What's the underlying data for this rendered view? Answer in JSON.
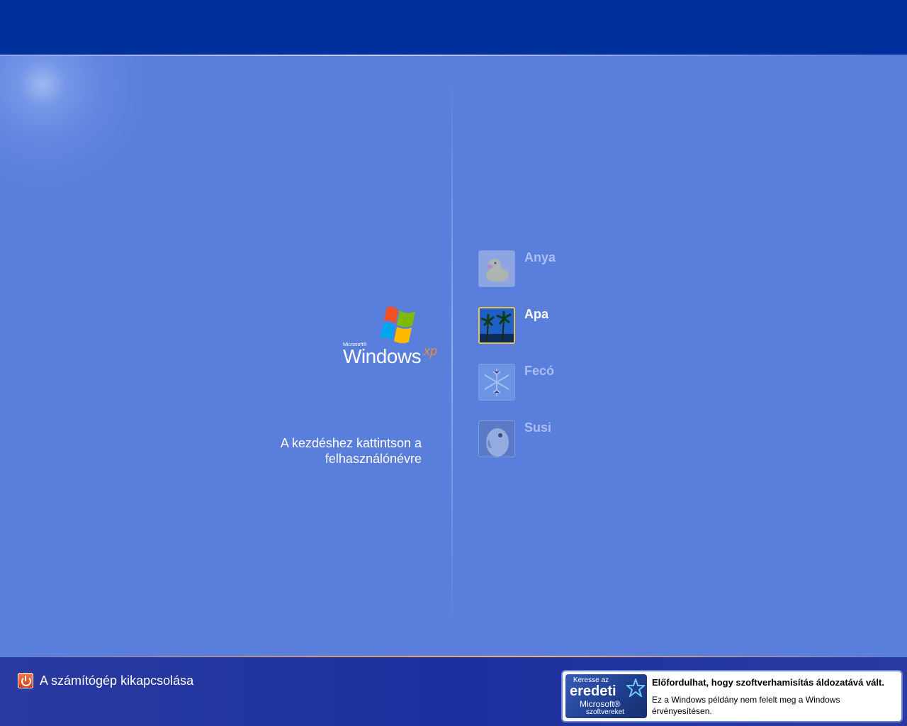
{
  "logo": {
    "microsoft": "Microsoft®",
    "windows": "Windows",
    "xp": "xp"
  },
  "instruction": {
    "line1": "A kezdéshez kattintson a",
    "line2": "felhasználónévre"
  },
  "users": [
    {
      "name": "Anya",
      "picture": "duck-icon",
      "selected": false
    },
    {
      "name": "Apa",
      "picture": "palm-trees-icon",
      "selected": true
    },
    {
      "name": "Fecó",
      "picture": "snowflake-icon",
      "selected": false
    },
    {
      "name": "Susi",
      "picture": "parrot-icon",
      "selected": false
    }
  ],
  "shutdown": {
    "label": "A számítógép kikapcsolása",
    "icon": "power-icon"
  },
  "notice": {
    "badge_line1": "Keresse az",
    "badge_line2": "eredeti",
    "badge_line3": "Microsoft®",
    "badge_line4": "szoftvereket",
    "title": "Előfordulhat, hogy szoftverhamisítás áldozatává vált.",
    "body": "Ez a Windows példány nem felelt meg a Windows érvényesítésen."
  },
  "colors": {
    "top_bar": "#00309c",
    "background": "#5a7edc",
    "bottom_bar": "#1c30a0",
    "selected_border": "#e8c24a"
  }
}
